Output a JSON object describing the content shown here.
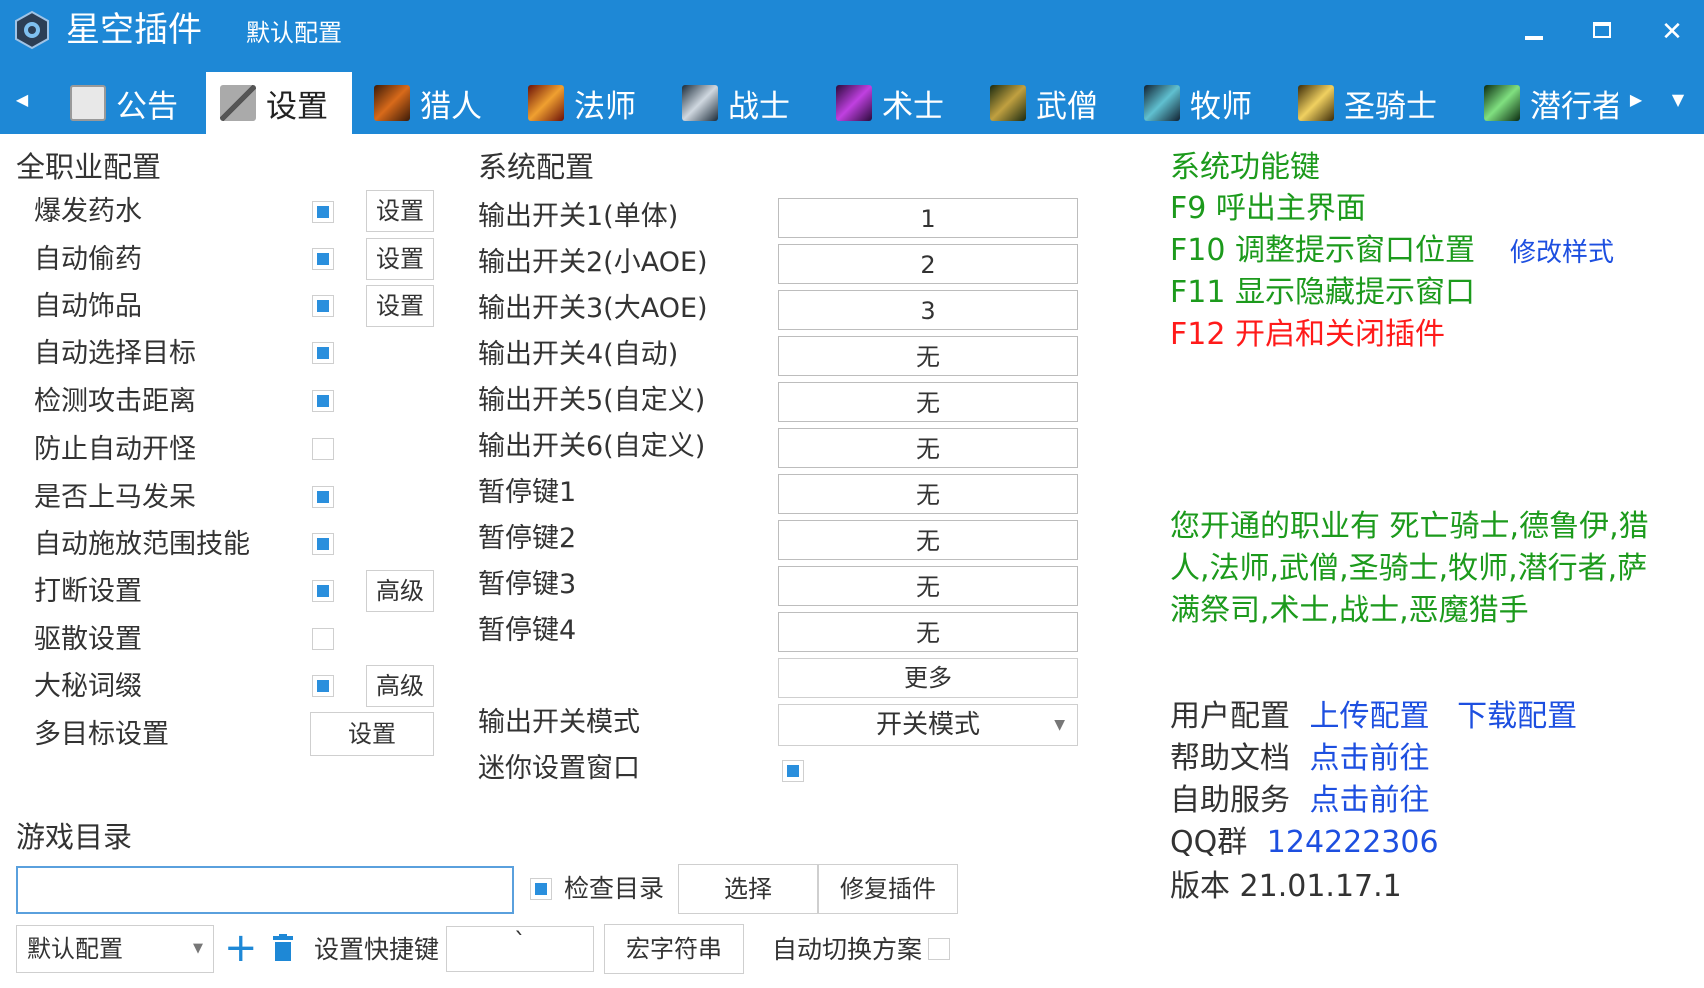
{
  "window": {
    "title": "星空插件",
    "config_name": "默认配置",
    "min_label": "▁",
    "max_label": "▢",
    "close_label": "✕"
  },
  "tabs": [
    {
      "label": "公告",
      "icon": "notice-icon"
    },
    {
      "label": "设置",
      "icon": "tools-icon"
    },
    {
      "label": "猎人",
      "icon": "hunter-icon"
    },
    {
      "label": "法师",
      "icon": "mage-icon"
    },
    {
      "label": "战士",
      "icon": "warrior-icon"
    },
    {
      "label": "术士",
      "icon": "warlock-icon"
    },
    {
      "label": "武僧",
      "icon": "monk-icon"
    },
    {
      "label": "牧师",
      "icon": "priest-icon"
    },
    {
      "label": "圣骑士",
      "icon": "paladin-icon"
    },
    {
      "label": "潜行者",
      "icon": "rogue-icon"
    }
  ],
  "all_class": {
    "title": "全职业配置",
    "items": [
      {
        "label": "爆发药水",
        "checked": true,
        "button": "设置"
      },
      {
        "label": "自动偷药",
        "checked": true,
        "button": "设置"
      },
      {
        "label": "自动饰品",
        "checked": true,
        "button": "设置"
      },
      {
        "label": "自动选择目标",
        "checked": true
      },
      {
        "label": "检测攻击距离",
        "checked": true
      },
      {
        "label": "防止自动开怪",
        "checked": false
      },
      {
        "label": "是否上马发呆",
        "checked": true
      },
      {
        "label": "自动施放范围技能",
        "checked": true
      },
      {
        "label": "打断设置",
        "checked": true,
        "button": "高级"
      },
      {
        "label": "驱散设置",
        "checked": false
      },
      {
        "label": "大秘词缀",
        "checked": true,
        "button": "高级"
      },
      {
        "label": "多目标设置",
        "button": "设置"
      }
    ]
  },
  "system": {
    "title": "系统配置",
    "keys": [
      {
        "label": "输出开关1(单体)",
        "value": "1"
      },
      {
        "label": "输出开关2(小AOE)",
        "value": "2"
      },
      {
        "label": "输出开关3(大AOE)",
        "value": "3"
      },
      {
        "label": "输出开关4(自动)",
        "value": "无"
      },
      {
        "label": "输出开关5(自定义)",
        "value": "无"
      },
      {
        "label": "输出开关6(自定义)",
        "value": "无"
      },
      {
        "label": "暂停键1",
        "value": "无"
      },
      {
        "label": "暂停键2",
        "value": "无"
      },
      {
        "label": "暂停键3",
        "value": "无"
      },
      {
        "label": "暂停键4",
        "value": "无"
      }
    ],
    "more_button": "更多",
    "mode_label": "输出开关模式",
    "mode_value": "开关模式",
    "mini_label": "迷你设置窗口",
    "mini_checked": true
  },
  "hotkeys": {
    "title": "系统功能键",
    "f9": "F9  呼出主界面",
    "f10": "F10 调整提示窗口位置",
    "f10_link": "修改样式",
    "f11": "F11 显示隐藏提示窗口",
    "f12": "F12 开启和关闭插件"
  },
  "classes_notice": {
    "line1": "您开通的职业有 死亡骑士,德鲁伊,猎",
    "line2": "人,法师,武僧,圣骑士,牧师,潜行者,萨",
    "line3": "满祭司,术士,战士,恶魔猎手"
  },
  "user": {
    "config_label": "用户配置",
    "upload": "上传配置",
    "download": "下载配置",
    "help_label": "帮助文档",
    "help_link": "点击前往",
    "service_label": "自助服务",
    "service_link": "点击前往",
    "qq_label": "QQ群",
    "qq_value": "124222306",
    "version": "版本 21.01.17.1"
  },
  "game_dir": {
    "title": "游戏目录",
    "path": "",
    "check_label": "检查目录",
    "check_checked": true,
    "select_button": "选择",
    "repair_button": "修复插件"
  },
  "bottom": {
    "profile": "默认配置",
    "add_label": "+",
    "shortcut_label": "设置快捷键",
    "shortcut_value": "`",
    "macro_button": "宏字符串",
    "auto_switch_label": "自动切换方案",
    "auto_switch_checked": false
  },
  "colors": {
    "titlebar": "#1e88d6",
    "checkbox": "#2a8fdd",
    "hotkey_green": "#1c9a1c",
    "f12_red": "#ff1a1a",
    "link_blue": "#1d4fe0"
  }
}
